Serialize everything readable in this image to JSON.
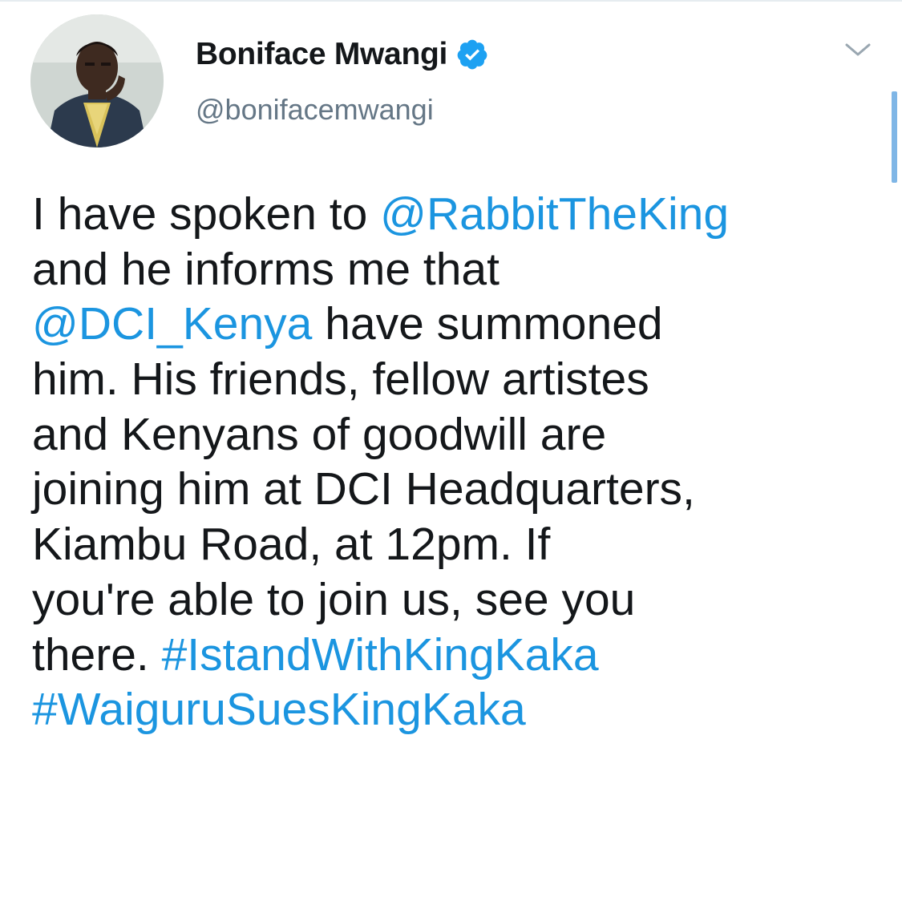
{
  "tweet": {
    "author": {
      "display_name": "Boniface Mwangi",
      "handle": "@bonifacemwangi",
      "verified": true,
      "avatar_icon": "user-avatar-photo"
    },
    "menu_icon": "chevron-down-icon",
    "text_lines": [
      [
        {
          "t": "I have spoken to "
        },
        {
          "t": "@RabbitTheKing",
          "link": true
        }
      ],
      [
        {
          "t": "and he informs me that"
        }
      ],
      [
        {
          "t": "@DCI_Kenya",
          "link": true
        },
        {
          "t": " have summoned"
        }
      ],
      [
        {
          "t": "him. His friends, fellow artistes"
        }
      ],
      [
        {
          "t": "and Kenyans of goodwill are"
        }
      ],
      [
        {
          "t": "joining him at DCI Headquarters,"
        }
      ],
      [
        {
          "t": "Kiambu Road, at 12pm. If"
        }
      ],
      [
        {
          "t": "you're able to join us, see you"
        }
      ],
      [
        {
          "t": "there. "
        },
        {
          "t": "#IstandWithKingKaka",
          "link": true
        }
      ],
      [
        {
          "t": "#WaiguruSuesKingKaka",
          "link": true
        }
      ]
    ]
  },
  "colors": {
    "text": "#14171a",
    "link": "#1b95e0",
    "secondary": "#657786",
    "verified_badge": "#1da1f2",
    "scrollbar": "#7fb6e6"
  }
}
